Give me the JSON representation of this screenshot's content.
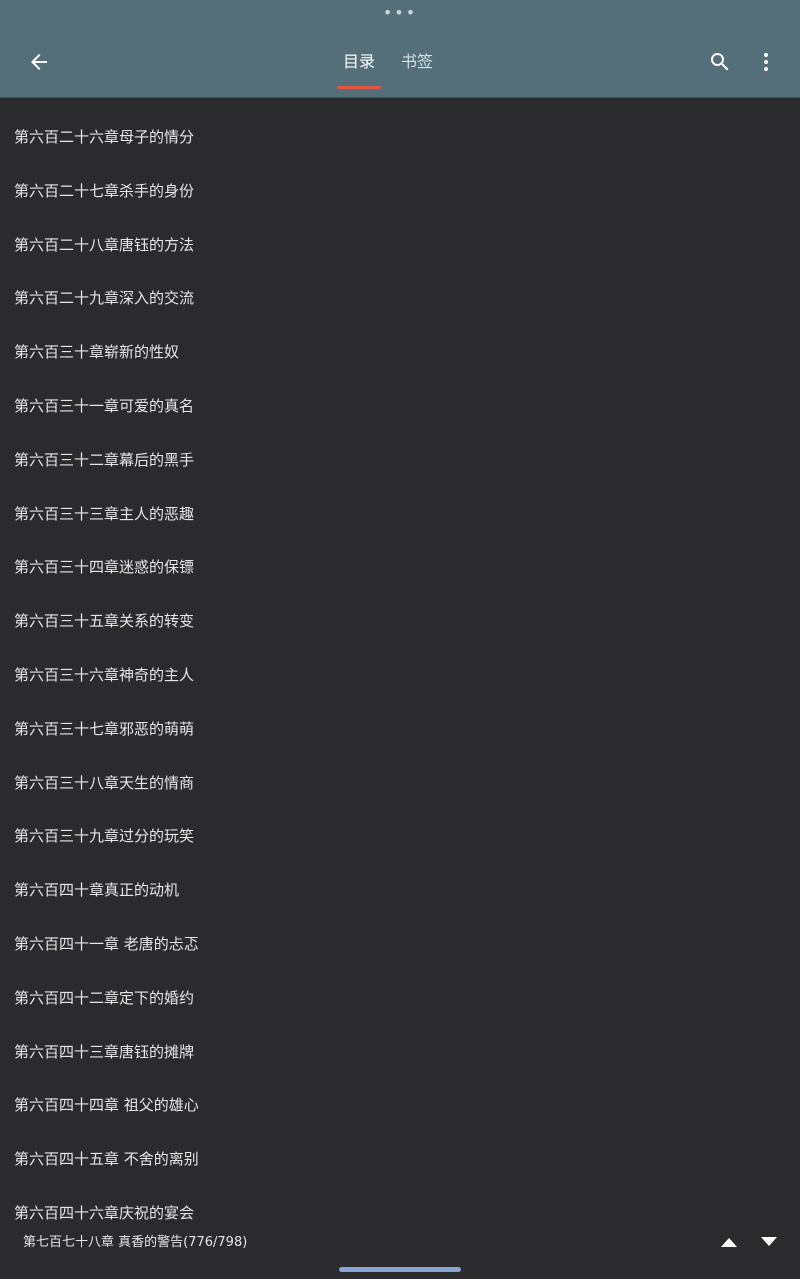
{
  "header": {
    "drag_handle": "•••",
    "tabs": [
      {
        "label": "目录",
        "active": true
      },
      {
        "label": "书签",
        "active": false
      }
    ]
  },
  "chapters": [
    "第六百二十六章母子的情分",
    "第六百二十七章杀手的身份",
    "第六百二十八章唐钰的方法",
    "第六百二十九章深入的交流",
    "第六百三十章崭新的性奴",
    "第六百三十一章可爱的真名",
    "第六百三十二章幕后的黑手",
    "第六百三十三章主人的恶趣",
    "第六百三十四章迷惑的保镖",
    "第六百三十五章关系的转变",
    "第六百三十六章神奇的主人",
    "第六百三十七章邪恶的萌萌",
    "第六百三十八章天生的情商",
    "第六百三十九章过分的玩笑",
    "第六百四十章真正的动机",
    "第六百四十一章 老唐的忐忑",
    "第六百四十二章定下的婚约",
    "第六百四十三章唐钰的摊牌",
    "第六百四十四章 祖父的雄心",
    "第六百四十五章 不舍的离别",
    "第六百四十六章庆祝的宴会"
  ],
  "footer": {
    "current_chapter": "第七百七十八章 真香的警告(776/798)"
  },
  "icons": {
    "back": "arrow-left-icon",
    "search": "search-icon",
    "more": "more-vert-icon",
    "up": "triangle-up-icon",
    "down": "triangle-down-icon"
  },
  "colors": {
    "header_bg": "#546e7a",
    "body_bg": "#2b2b2d",
    "tab_indicator": "#e2553f",
    "text": "#e6e6e6",
    "home_indicator": "#8aa4d6"
  }
}
